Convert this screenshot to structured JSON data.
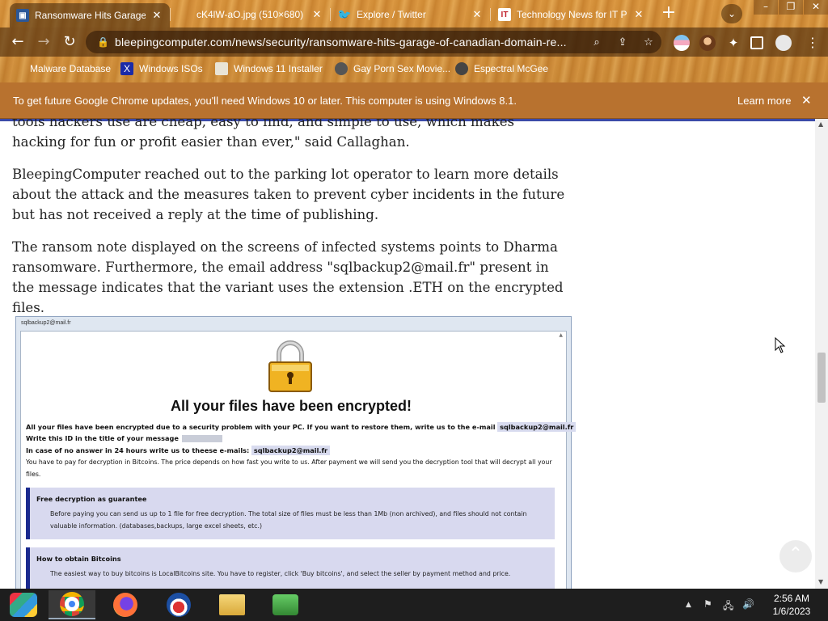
{
  "browser": {
    "tabs": [
      {
        "title": "Ransomware Hits Garage o",
        "active": true
      },
      {
        "title": "cK4lW-aO.jpg (510×680)",
        "active": false
      },
      {
        "title": "Explore / Twitter",
        "active": false
      },
      {
        "title": "Technology News for IT P",
        "active": false
      }
    ],
    "new_tab": "+",
    "address_bar": {
      "url": "bleepingcomputer.com/news/security/ransomware-hits-garage-of-canadian-domain-re..."
    },
    "bookmarks": [
      {
        "label": "Malware Database",
        "icon": "malware-db-icon"
      },
      {
        "label": "Windows ISOs",
        "icon": "x-icon"
      },
      {
        "label": "Windows 11 Installer",
        "icon": "installer-icon"
      },
      {
        "label": "Gay Porn Sex Movie...",
        "icon": "site-icon"
      },
      {
        "label": "Espectral McGee",
        "icon": "avatar-icon"
      }
    ]
  },
  "infobar": {
    "message": "To get future Google Chrome updates, you'll need Windows 10 or later. This computer is using Windows 8.1.",
    "learn_more": "Learn more",
    "close": "✕"
  },
  "article": {
    "paragraphs": [
      "tools hackers use are cheap, easy to find, and simple to use, which makes hacking for fun or profit easier than ever,\" said Callaghan.",
      "BleepingComputer reached out to the parking lot operator to learn more details about the attack and the measures taken to prevent cyber incidents in the future but has not received a reply at the time of publishing.",
      "The ransom note displayed on the screens of infected systems points to Dharma ransomware. Furthermore, the email address \"sqlbackup2@mail.fr\" present in the message indicates that the variant uses the extension .ETH on the encrypted files."
    ]
  },
  "ransom_note": {
    "window_title": "sqlbackup2@mail.fr",
    "heading": "All your files have been encrypted!",
    "line1": "All your files have been encrypted due to a security problem with your PC. If you want to restore them, write us to the e-mail",
    "email1": "sqlbackup2@mail.fr",
    "line2": "Write this ID in the title of your message",
    "line3": "In case of no answer in 24 hours write us to theese e-mails:",
    "email2": "sqlbackup2@mail.fr",
    "line4": "You have to pay for decryption in Bitcoins. The price depends on how fast you write to us. After payment we will send you the decryption tool that will decrypt all your",
    "line4b": "files.",
    "box1_title": "Free decryption as guarantee",
    "box1_body": "Before paying you can send us up to 1 file for free decryption. The total size of files must be less than 1Mb (non archived), and files should not contain valuable information. (databases,backups, large excel sheets, etc.)",
    "box2_title": "How to obtain Bitcoins",
    "box2_body": "The easiest way to buy bitcoins is LocalBitcoins site. You have to register, click 'Buy bitcoins', and select the seller by payment method and price."
  },
  "taskbar": {
    "time": "2:56 AM",
    "date": "1/6/2023"
  }
}
